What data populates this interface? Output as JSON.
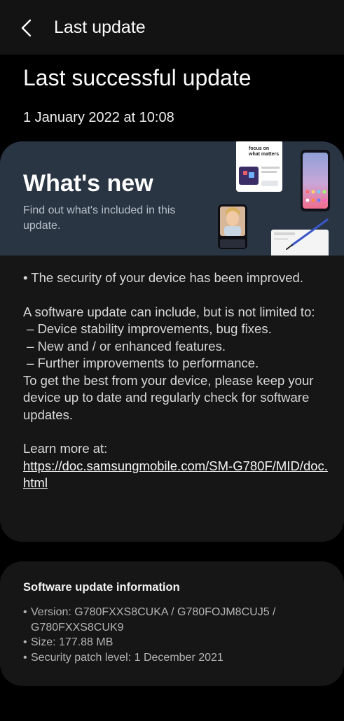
{
  "header": {
    "title": "Last update"
  },
  "page": {
    "title": "Last successful update",
    "date": "1 January 2022 at 10:08"
  },
  "whats_new": {
    "title": "What's new",
    "subtitle": "Find out what's included in this update.",
    "phone_mock_text": "focus on what matters"
  },
  "details": {
    "security_line": "• The security of your device has been improved.",
    "intro": "A software update can include, but is not limited to:",
    "items": [
      " – Device stability improvements, bug fixes.",
      " – New and / or enhanced features.",
      " – Further improvements to performance."
    ],
    "advice": "To get the best from your device, please keep your device up to date and regularly check for software updates.",
    "learn_more": "Learn more at:",
    "link": "https://doc.samsungmobile.com/SM-G780F/MID/doc.html"
  },
  "info": {
    "title": "Software update information",
    "version": "Version: G780FXXS8CUKA / G780FOJM8CUJ5 / G780FXXS8CUK9",
    "size": "Size: 177.88 MB",
    "patch": "Security patch level: 1 December 2021"
  },
  "colors": {
    "background": "#000000",
    "card": "#161616",
    "banner": "#2a3544"
  }
}
